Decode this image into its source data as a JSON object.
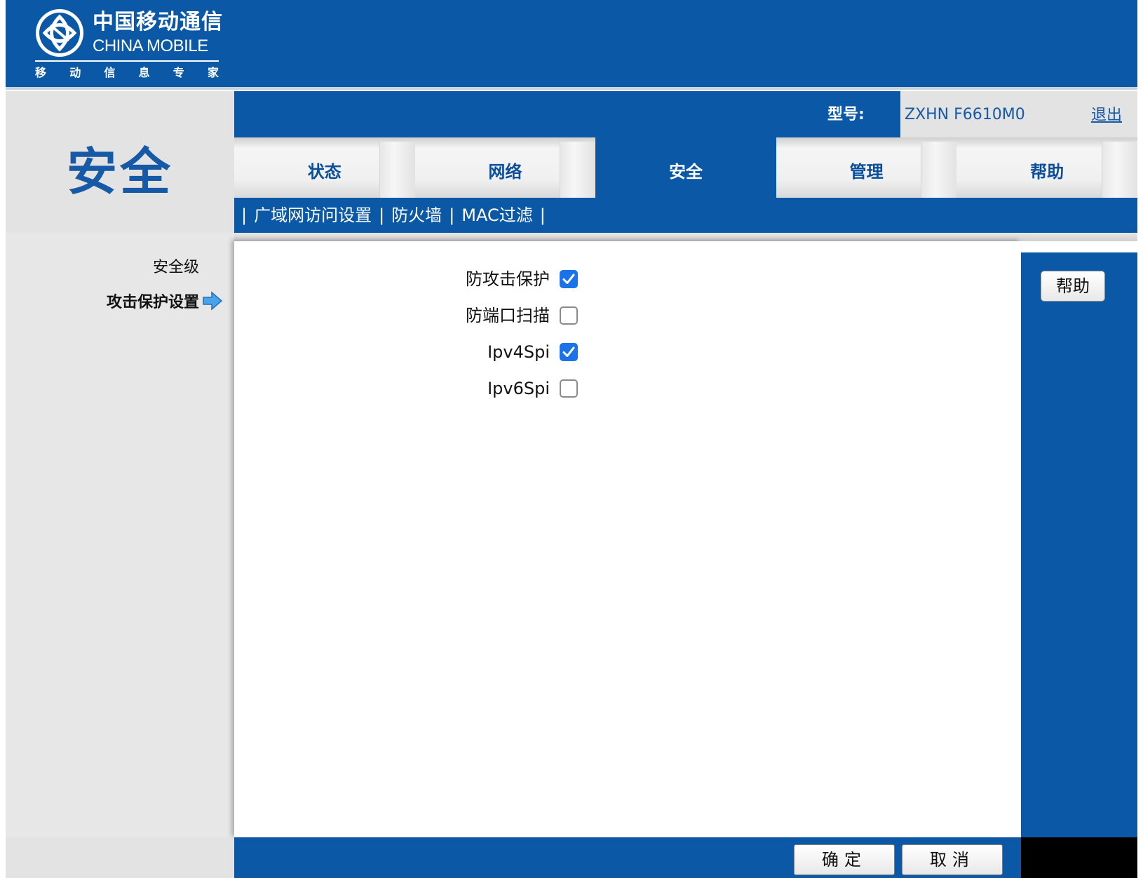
{
  "logo": {
    "cn": "中国移动通信",
    "en": "CHINA MOBILE",
    "tagline": [
      "移",
      "动",
      "信",
      "息",
      "专",
      "家"
    ]
  },
  "section_title": "安全",
  "model": {
    "label": "型号:",
    "value": "ZXHN F6610M0"
  },
  "logout": "退出",
  "tabs": [
    {
      "label": "状态",
      "active": false
    },
    {
      "label": "网络",
      "active": false
    },
    {
      "label": "安全",
      "active": true
    },
    {
      "label": "管理",
      "active": false
    },
    {
      "label": "帮助",
      "active": false
    }
  ],
  "subnav": {
    "sep": "|",
    "items": [
      "广域网访问设置",
      "防火墙",
      "MAC过滤"
    ]
  },
  "leftnav": {
    "items": [
      "安全级",
      "攻击保护设置"
    ],
    "active_index": 1
  },
  "options": [
    {
      "label": "防攻击保护",
      "checked": true
    },
    {
      "label": "防端口扫描",
      "checked": false
    },
    {
      "label": "Ipv4Spi",
      "checked": true
    },
    {
      "label": "Ipv6Spi",
      "checked": false
    }
  ],
  "help_button": "帮助",
  "footer": {
    "ok": "确定",
    "cancel": "取消"
  },
  "colors": {
    "brand_blue": "#0b59a6",
    "checkbox_blue": "#1a73e8",
    "panel_grey": "#e7e7e7"
  }
}
